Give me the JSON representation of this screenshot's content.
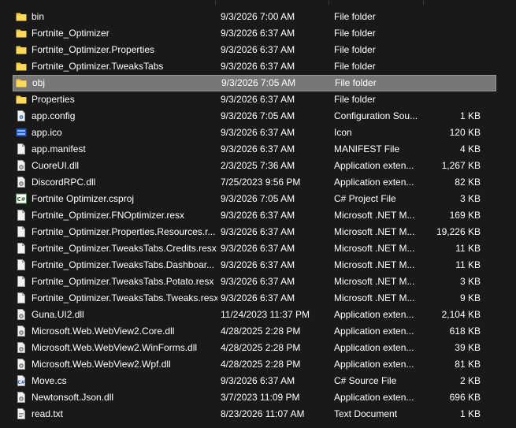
{
  "colors": {
    "background": "#191919",
    "selected_row": "#777777",
    "folder": "#f4c542",
    "text": "#ffffff"
  },
  "files": [
    {
      "name": "bin",
      "date": "9/3/2026 7:00 AM",
      "type": "File folder",
      "size": "",
      "icon": "folder-icon"
    },
    {
      "name": "Fortnite_Optimizer",
      "date": "9/3/2026 6:37 AM",
      "type": "File folder",
      "size": "",
      "icon": "folder-icon"
    },
    {
      "name": "Fortnite_Optimizer.Properties",
      "date": "9/3/2026 6:37 AM",
      "type": "File folder",
      "size": "",
      "icon": "folder-icon"
    },
    {
      "name": "Fortnite_Optimizer.TweaksTabs",
      "date": "9/3/2026 6:37 AM",
      "type": "File folder",
      "size": "",
      "icon": "folder-icon"
    },
    {
      "name": "obj",
      "date": "9/3/2026 7:05 AM",
      "type": "File folder",
      "size": "",
      "icon": "folder-icon",
      "selected": true
    },
    {
      "name": "Properties",
      "date": "9/3/2026 6:37 AM",
      "type": "File folder",
      "size": "",
      "icon": "folder-icon"
    },
    {
      "name": "app.config",
      "date": "9/3/2026 7:05 AM",
      "type": "Configuration Sou...",
      "size": "1 KB",
      "icon": "config-file-icon"
    },
    {
      "name": "app.ico",
      "date": "9/3/2026 6:37 AM",
      "type": "Icon",
      "size": "120 KB",
      "icon": "ico-file-icon"
    },
    {
      "name": "app.manifest",
      "date": "9/3/2026 6:37 AM",
      "type": "MANIFEST File",
      "size": "4 KB",
      "icon": "document-icon"
    },
    {
      "name": "CuoreUI.dll",
      "date": "2/3/2025 7:36 AM",
      "type": "Application exten...",
      "size": "1,267 KB",
      "icon": "dll-file-icon"
    },
    {
      "name": "DiscordRPC.dll",
      "date": "7/25/2023 9:56 PM",
      "type": "Application exten...",
      "size": "82 KB",
      "icon": "dll-file-icon"
    },
    {
      "name": "Fortnite Optimizer.csproj",
      "date": "9/3/2026 7:05 AM",
      "type": "C# Project File",
      "size": "3 KB",
      "icon": "csproj-file-icon"
    },
    {
      "name": "Fortnite_Optimizer.FNOptimizer.resx",
      "date": "9/3/2026 6:37 AM",
      "type": "Microsoft .NET M...",
      "size": "169 KB",
      "icon": "document-icon"
    },
    {
      "name": "Fortnite_Optimizer.Properties.Resources.r...",
      "date": "9/3/2026 6:37 AM",
      "type": "Microsoft .NET M...",
      "size": "19,226 KB",
      "icon": "document-icon"
    },
    {
      "name": "Fortnite_Optimizer.TweaksTabs.Credits.resx",
      "date": "9/3/2026 6:37 AM",
      "type": "Microsoft .NET M...",
      "size": "11 KB",
      "icon": "document-icon"
    },
    {
      "name": "Fortnite_Optimizer.TweaksTabs.Dashboar...",
      "date": "9/3/2026 6:37 AM",
      "type": "Microsoft .NET M...",
      "size": "11 KB",
      "icon": "document-icon"
    },
    {
      "name": "Fortnite_Optimizer.TweaksTabs.Potato.resx",
      "date": "9/3/2026 6:37 AM",
      "type": "Microsoft .NET M...",
      "size": "3 KB",
      "icon": "document-icon"
    },
    {
      "name": "Fortnite_Optimizer.TweaksTabs.Tweaks.resx",
      "date": "9/3/2026 6:37 AM",
      "type": "Microsoft .NET M...",
      "size": "9 KB",
      "icon": "document-icon"
    },
    {
      "name": "Guna.UI2.dll",
      "date": "11/24/2023 11:37 PM",
      "type": "Application exten...",
      "size": "2,104 KB",
      "icon": "dll-file-icon"
    },
    {
      "name": "Microsoft.Web.WebView2.Core.dll",
      "date": "4/28/2025 2:28 PM",
      "type": "Application exten...",
      "size": "618 KB",
      "icon": "dll-file-icon"
    },
    {
      "name": "Microsoft.Web.WebView2.WinForms.dll",
      "date": "4/28/2025 2:28 PM",
      "type": "Application exten...",
      "size": "39 KB",
      "icon": "dll-file-icon"
    },
    {
      "name": "Microsoft.Web.WebView2.Wpf.dll",
      "date": "4/28/2025 2:28 PM",
      "type": "Application exten...",
      "size": "81 KB",
      "icon": "dll-file-icon"
    },
    {
      "name": "Move.cs",
      "date": "9/3/2026 6:37 AM",
      "type": "C# Source File",
      "size": "2 KB",
      "icon": "cs-file-icon"
    },
    {
      "name": "Newtonsoft.Json.dll",
      "date": "3/7/2023 11:09 PM",
      "type": "Application exten...",
      "size": "696 KB",
      "icon": "dll-file-icon"
    },
    {
      "name": "read.txt",
      "date": "8/23/2026 11:07 AM",
      "type": "Text Document",
      "size": "1 KB",
      "icon": "text-file-icon"
    }
  ]
}
